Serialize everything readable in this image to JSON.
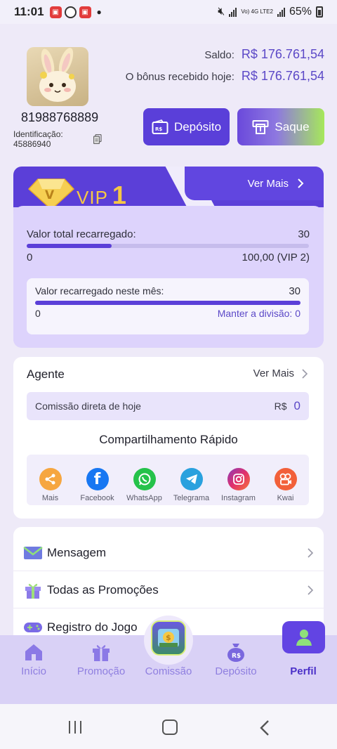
{
  "status_bar": {
    "time": "11:01",
    "network": "Vo) 4G LTE2",
    "battery": "65%"
  },
  "profile": {
    "phone": "81988768889",
    "id_label": "Identificação:",
    "id_value": "45886940"
  },
  "balance": {
    "saldo_label": "Saldo:",
    "saldo_value": "R$ 176.761,54",
    "bonus_label": "O bônus recebido hoje:",
    "bonus_value": "R$ 176.761,54"
  },
  "actions": {
    "deposit_label": "Depósito",
    "withdraw_label": "Saque"
  },
  "vip": {
    "label": "VIP",
    "level": "1",
    "more_label": "Ver Mais",
    "total_label": "Valor total recarregado:",
    "total_value": "30",
    "total_min": "0",
    "total_max": "100,00 (VIP 2)",
    "total_progress": 0.3,
    "month_label": "Valor recarregado neste mês:",
    "month_value": "30",
    "month_min": "0",
    "month_keep": "Manter a divisão: 0",
    "month_progress": 1.0
  },
  "agent": {
    "title": "Agente",
    "more_label": "Ver Mais",
    "commission_label": "Comissão direta de hoje",
    "commission_currency": "R$",
    "commission_value": "0",
    "share_title": "Compartilhamento Rápido",
    "share_items": [
      {
        "name": "Mais",
        "color": "#f6a640"
      },
      {
        "name": "Facebook",
        "color": "#1877f2"
      },
      {
        "name": "WhatsApp",
        "color": "#25c24a"
      },
      {
        "name": "Telegrama",
        "color": "#2aa1de"
      },
      {
        "name": "Instagram",
        "color": "#d6307e"
      },
      {
        "name": "Kwai",
        "color": "#f2603a"
      }
    ]
  },
  "menu": {
    "items": [
      {
        "label": "Mensagem"
      },
      {
        "label": "Todas as Promoções"
      },
      {
        "label": "Registro do Jogo"
      }
    ]
  },
  "bottom_nav": {
    "items": [
      {
        "label": "Início"
      },
      {
        "label": "Promoção"
      },
      {
        "label": "Comissão"
      },
      {
        "label": "Depósito"
      },
      {
        "label": "Perfil"
      }
    ],
    "active": "Perfil"
  },
  "colors": {
    "accent": "#5b3fd8",
    "vip_gold": "#f6c844",
    "value_text": "#5b48c7"
  }
}
